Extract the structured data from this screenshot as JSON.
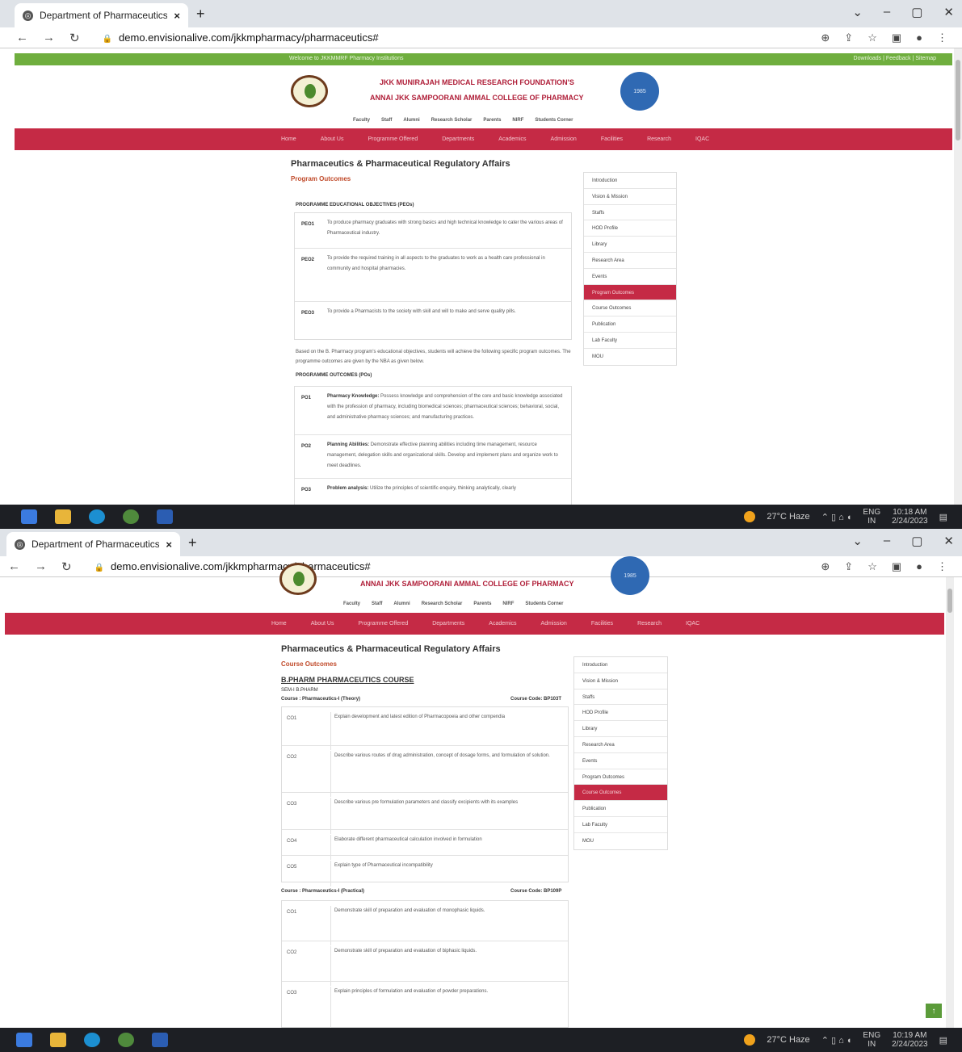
{
  "browser": {
    "tab_title": "Department of Pharmaceutics &",
    "tab_close": "×",
    "new_tab": "+",
    "url": "demo.envisionalive.com/jkkmpharmacy/pharmaceutics#",
    "window_controls": [
      "⌄",
      "–",
      "▢",
      "✕"
    ]
  },
  "site": {
    "welcome": "Welcome to JKKMMRF Pharmacy Institutions",
    "top_right_links": "Downloads | Feedback | Sitemap",
    "header_line1": "JKK MUNIRAJAH MEDICAL RESEARCH FOUNDATION'S",
    "header_line2": "ANNAI JKK SAMPOORANI AMMAL COLLEGE OF PHARMACY",
    "right_logo_text": "1985",
    "top_links": [
      "Faculty",
      "Staff",
      "Alumni",
      "Research Scholar",
      "Parents",
      "NIRF",
      "Students Corner"
    ],
    "main_nav": [
      "Home",
      "About Us",
      "Programme Offered",
      "Departments",
      "Academics",
      "Admission",
      "Facilities",
      "Research",
      "IQAC"
    ],
    "page_title": "Pharmaceutics & Pharmaceutical Regulatory Affairs",
    "sidebar": [
      "Introduction",
      "Vision & Mission",
      "Staffs",
      "HOD Profile",
      "Library",
      "Research Area",
      "Events",
      "Program Outcomes",
      "Course Outcomes",
      "Publication",
      "Lab Faculty",
      "MOU"
    ]
  },
  "view1": {
    "subtitle": "Program Outcomes",
    "peo_heading": "PROGRAMME EDUCATIONAL OBJECTIVES (PEOs)",
    "peos": [
      {
        "code": "PEO1",
        "text": "To produce pharmacy graduates with strong basics and high technical knowledge to cater the various areas of Pharmaceutical industry."
      },
      {
        "code": "PEO2",
        "text": "To provide the required training in all aspects to the graduates to work as a health care professional in community and hospital pharmacies."
      },
      {
        "code": "PEO3",
        "text": "To provide a Pharmacists to the society with skill and will to make and serve quality pills."
      }
    ],
    "based_on": "Based on the B. Pharmacy program's educational objectives, students will achieve the following specific program outcomes. The programme outcomes are given by the NBA as given below.",
    "po_heading": "PROGRAMME OUTCOMES (POs)",
    "pos": [
      {
        "code": "PO1",
        "title": "Pharmacy Knowledge:",
        "text": "Possess knowledge and comprehension of the core and basic knowledge associated with the profession of pharmacy, including biomedical sciences; pharmaceutical sciences; behavioral, social, and administrative pharmacy sciences; and manufacturing practices."
      },
      {
        "code": "PO2",
        "title": "Planning Abilities:",
        "text": "Demonstrate effective planning abilities including time management, resource management, delegation skills and organizational skills. Develop and implement plans and organize work to meet deadlines."
      },
      {
        "code": "PO3",
        "title": "Problem analysis:",
        "text": "Utilize the principles of scientific enquiry, thinking analytically, clearly"
      }
    ],
    "active_item": "Program Outcomes",
    "taskbar": {
      "weather": "27°C Haze",
      "lang": "ENG",
      "region": "IN",
      "time": "10:18 AM",
      "date": "2/24/2023"
    }
  },
  "view2": {
    "subtitle": "Course Outcomes",
    "course_heading": "B.PHARM PHARMACEUTICS COURSE",
    "semester": "SEM-I B.PHARM",
    "courses": [
      {
        "name": "Course : Pharmaceutics-I (Theory)",
        "code": "Course Code: BP103T",
        "rows": [
          {
            "code": "CO1",
            "text": "Explain development and latest edition of Pharmacopoeia and other compendia"
          },
          {
            "code": "CO2",
            "text": "Describe various routes of drug administration, concept of dosage forms, and formulation of solution."
          },
          {
            "code": "CO3",
            "text": "Describe various pre formulation parameters and classify excipients with its examples"
          },
          {
            "code": "CO4",
            "text": "Elaborate different pharmaceutical calculation involved in formulation"
          },
          {
            "code": "CO5",
            "text": "Explain type of Pharmaceutical incompatibility"
          }
        ]
      },
      {
        "name": "Course : Pharmaceutics-I (Practical)",
        "code": "Course Code: BP109P",
        "rows": [
          {
            "code": "CO1",
            "text": "Demonstrate skill of preparation and evaluation of monophasic liquids."
          },
          {
            "code": "CO2",
            "text": "Demonstrate skill of preparation and evaluation of biphasic liquids."
          },
          {
            "code": "CO3",
            "text": "Explain principles of formulation and evaluation of powder preparations."
          }
        ]
      }
    ],
    "active_item": "Course Outcomes",
    "back_to_top": "↑",
    "taskbar": {
      "weather": "27°C Haze",
      "lang": "ENG",
      "region": "IN",
      "time": "10:19 AM",
      "date": "2/24/2023"
    }
  },
  "colors": {
    "accent_red": "#c52a45",
    "top_green": "#6fae3e",
    "title_red": "#b0203a"
  }
}
